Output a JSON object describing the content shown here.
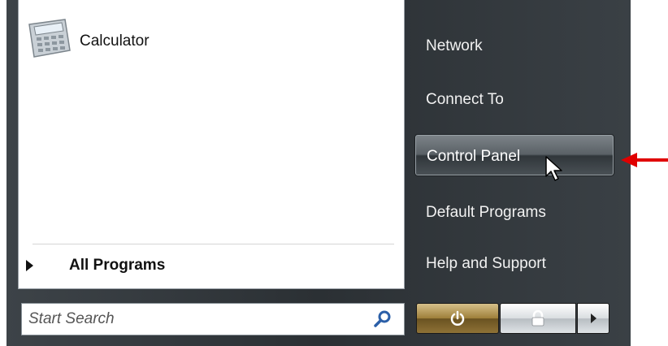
{
  "start_menu": {
    "left_pane": {
      "pinned": [
        {
          "label": "Calculator",
          "icon": "calculator-icon"
        }
      ],
      "all_programs": {
        "label": "All Programs",
        "icon": "triangle-right-icon"
      }
    },
    "search": {
      "placeholder": "Start Search",
      "icon": "magnifier-icon"
    },
    "right_pane": {
      "items": [
        {
          "label": "Network"
        },
        {
          "label": "Connect To"
        },
        {
          "label": "Control Panel",
          "highlighted": true
        },
        {
          "label": "Default Programs"
        },
        {
          "label": "Help and Support"
        }
      ]
    },
    "buttons": {
      "power": {
        "icon": "power-icon"
      },
      "lock": {
        "icon": "lock-icon"
      },
      "options": {
        "icon": "arrow-right-icon"
      }
    }
  },
  "annotation": {
    "icon": "red-arrow-icon",
    "color": "#e00000"
  },
  "colors": {
    "frame": "#2f3539",
    "accent_power": "#9e7f3a"
  }
}
